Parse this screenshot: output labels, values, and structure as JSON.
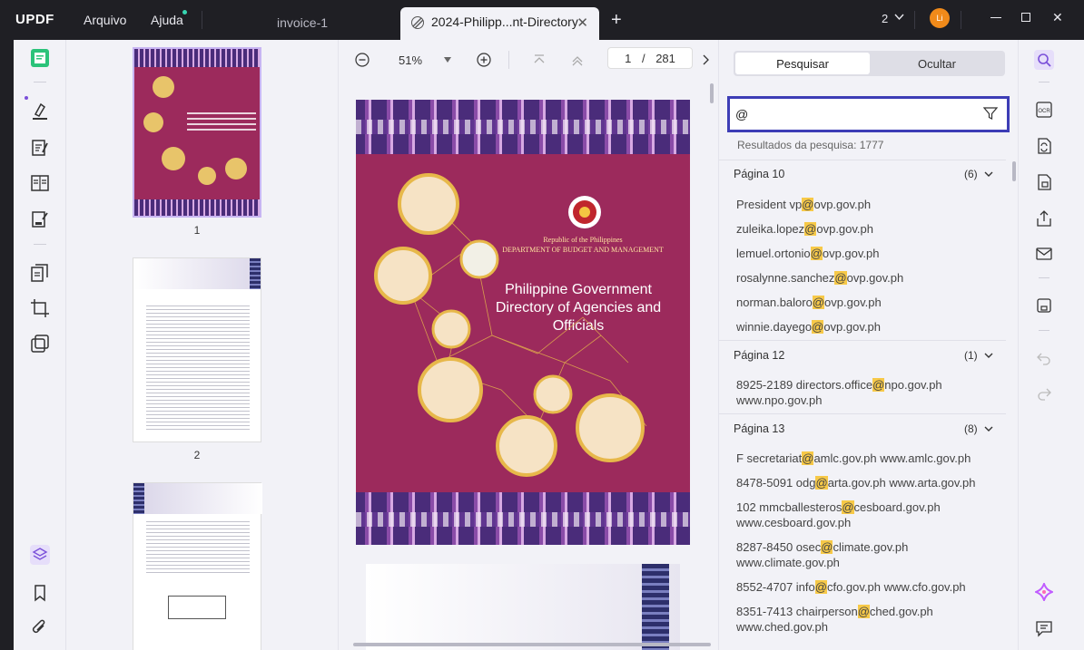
{
  "app": {
    "logo": "UPDF"
  },
  "menu": {
    "file": "Arquivo",
    "help": "Ajuda"
  },
  "tabs": [
    {
      "label": "invoice-1",
      "active": false
    },
    {
      "label": "2024-Philipp...nt-Directory",
      "active": true
    }
  ],
  "titlebar": {
    "page_indicator": "2",
    "avatar_initials": "Li"
  },
  "thumbnails": [
    {
      "number": "1"
    },
    {
      "number": "2"
    }
  ],
  "viewer": {
    "zoom": "51%",
    "current_page": "1",
    "page_separator": "/",
    "total_pages": "281",
    "cover": {
      "dept_line1": "Republic of the Philippines",
      "dept_line2": "DEPARTMENT OF BUDGET AND MANAGEMENT",
      "title": "Philippine Government Directory of Agencies and Officials"
    }
  },
  "search": {
    "tab_search": "Pesquisar",
    "tab_hide": "Ocultar",
    "query": "@",
    "results_summary": "Resultados da pesquisa: 1777",
    "groups": [
      {
        "page": "Página 10",
        "count": "(6)",
        "results": [
          {
            "before": "President vp",
            "match": "@",
            "after": "ovp.gov.ph"
          },
          {
            "before": "zuleika.lopez",
            "match": "@",
            "after": "ovp.gov.ph"
          },
          {
            "before": "lemuel.ortonio",
            "match": "@",
            "after": "ovp.gov.ph"
          },
          {
            "before": "rosalynne.sanchez",
            "match": "@",
            "after": "ovp.gov.ph"
          },
          {
            "before": "norman.baloro",
            "match": "@",
            "after": "ovp.gov.ph"
          },
          {
            "before": "winnie.dayego",
            "match": "@",
            "after": "ovp.gov.ph"
          }
        ]
      },
      {
        "page": "Página 12",
        "count": "(1)",
        "results": [
          {
            "before": "8925-2189 directors.office",
            "match": "@",
            "after": "npo.gov.ph www.npo.gov.ph"
          }
        ]
      },
      {
        "page": "Página 13",
        "count": "(8)",
        "results": [
          {
            "before": "F secretariat",
            "match": "@",
            "after": "amlc.gov.ph www.amlc.gov.ph"
          },
          {
            "before": "8478-5091 odg",
            "match": "@",
            "after": "arta.gov.ph www.arta.gov.ph"
          },
          {
            "before": "102 mmcballesteros",
            "match": "@",
            "after": "cesboard.gov.ph www.cesboard.gov.ph"
          },
          {
            "before": "8287-8450 osec",
            "match": "@",
            "after": "climate.gov.ph www.climate.gov.ph"
          },
          {
            "before": "8552-4707 info",
            "match": "@",
            "after": "cfo.gov.ph www.cfo.gov.ph"
          },
          {
            "before": "8351-7413 chairperson",
            "match": "@",
            "after": "ched.gov.ph www.ched.gov.ph"
          }
        ]
      }
    ]
  },
  "colors": {
    "accent": "#3d3db6",
    "highlight": "#f7c948",
    "brand": "#b07cff",
    "cover": "#9c2a5c"
  }
}
